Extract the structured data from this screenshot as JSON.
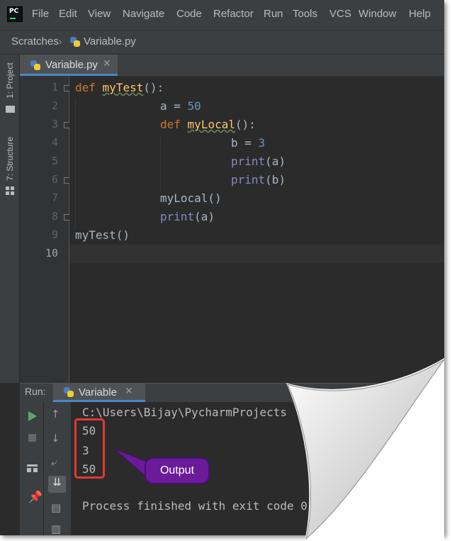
{
  "menu": {
    "items": [
      {
        "label": "File",
        "underline": "F"
      },
      {
        "label": "Edit",
        "underline": "E"
      },
      {
        "label": "View",
        "underline": "V"
      },
      {
        "label": "Navigate",
        "underline": "N"
      },
      {
        "label": "Code",
        "underline": "C"
      },
      {
        "label": "Refactor",
        "underline": "R"
      },
      {
        "label": "Run",
        "underline": "u"
      },
      {
        "label": "Tools",
        "underline": "T"
      },
      {
        "label": "VCS",
        "underline": "S"
      },
      {
        "label": "Window",
        "underline": "W"
      },
      {
        "label": "Help",
        "underline": "H"
      }
    ]
  },
  "breadcrumb": {
    "root": "Scratches",
    "file": "Variable.py"
  },
  "side_tools": {
    "project": "1: Project",
    "structure": "7: Structure"
  },
  "editor": {
    "tab_label": "Variable.py",
    "line_numbers": [
      "1",
      "2",
      "3",
      "4",
      "5",
      "6",
      "7",
      "8",
      "9",
      "10"
    ],
    "lines": {
      "l1_kw": "def",
      "l1_fn": "myTest",
      "l1_rest": "():",
      "l2_a": "a = ",
      "l2_num": "50",
      "l3_kw": "def",
      "l3_fn": "myLocal",
      "l3_rest": "():",
      "l4_b": "b = ",
      "l4_num": "3",
      "l5_fn": "print",
      "l5_rest": "(a)",
      "l6_fn": "print",
      "l6_rest": "(b)",
      "l7": "myLocal()",
      "l8_fn": "print",
      "l8_rest": "(a)",
      "l9": "myTest()"
    }
  },
  "run_panel": {
    "title": "Run:",
    "tab_label": "Variable",
    "console": {
      "command": "C:\\Users\\Bijay\\PycharmProjects",
      "outputs": [
        "50",
        "3",
        "50"
      ],
      "finished": "Process finished with exit code 0"
    }
  },
  "annotation": {
    "label": "Output"
  },
  "colors": {
    "keyword": "#cc7832",
    "function": "#ffc66d",
    "number": "#6897bb",
    "builtin": "#8888c6",
    "annotation_box": "#e53935",
    "annotation_bubble": "#6a1b9a"
  }
}
